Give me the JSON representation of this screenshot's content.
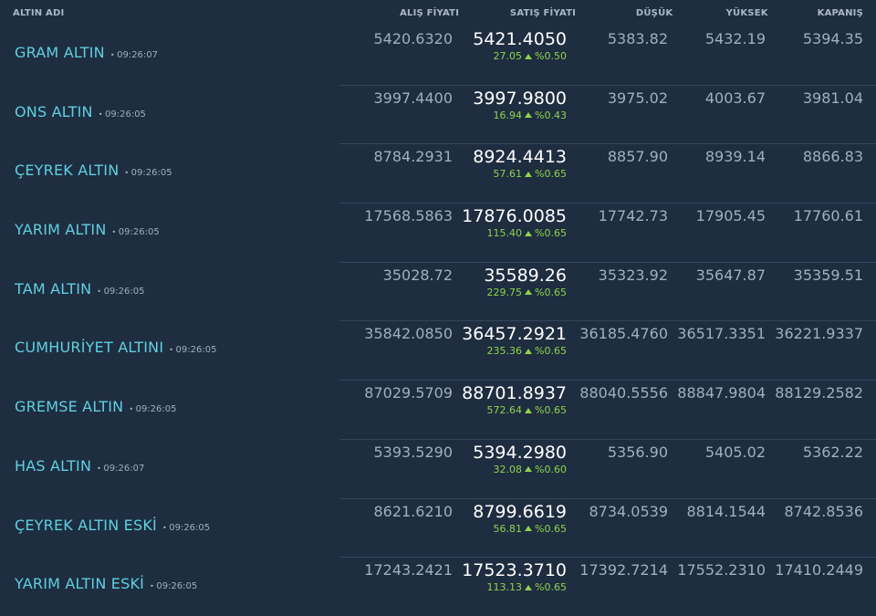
{
  "header": {
    "name": "ALTIN ADI",
    "alis": "ALIŞ FİYATI",
    "satis": "SATIŞ FİYATI",
    "dusuk": "DÜŞÜK",
    "yuksek": "YÜKSEK",
    "kapanis": "KAPANIŞ"
  },
  "rows": [
    {
      "name": "GRAM ALTIN",
      "time": "09:26:07",
      "alis": "5420.6320",
      "satis": "5421.4050",
      "change": "27.05",
      "pct": "%0.50",
      "dusuk": "5383.82",
      "yuksek": "5432.19",
      "kapanis": "5394.35"
    },
    {
      "name": "ONS ALTIN",
      "time": "09:26:05",
      "alis": "3997.4400",
      "satis": "3997.9800",
      "change": "16.94",
      "pct": "%0.43",
      "dusuk": "3975.02",
      "yuksek": "4003.67",
      "kapanis": "3981.04"
    },
    {
      "name": "ÇEYREK ALTIN",
      "time": "09:26:05",
      "alis": "8784.2931",
      "satis": "8924.4413",
      "change": "57.61",
      "pct": "%0.65",
      "dusuk": "8857.90",
      "yuksek": "8939.14",
      "kapanis": "8866.83"
    },
    {
      "name": "YARIM ALTIN",
      "time": "09:26:05",
      "alis": "17568.5863",
      "satis": "17876.0085",
      "change": "115.40",
      "pct": "%0.65",
      "dusuk": "17742.73",
      "yuksek": "17905.45",
      "kapanis": "17760.61"
    },
    {
      "name": "TAM ALTIN",
      "time": "09:26:05",
      "alis": "35028.72",
      "satis": "35589.26",
      "change": "229.75",
      "pct": "%0.65",
      "dusuk": "35323.92",
      "yuksek": "35647.87",
      "kapanis": "35359.51"
    },
    {
      "name": "CUMHURİYET ALTINI",
      "time": "09:26:05",
      "alis": "35842.0850",
      "satis": "36457.2921",
      "change": "235.36",
      "pct": "%0.65",
      "dusuk": "36185.4760",
      "yuksek": "36517.3351",
      "kapanis": "36221.9337"
    },
    {
      "name": "GREMSE ALTIN",
      "time": "09:26:05",
      "alis": "87029.5709",
      "satis": "88701.8937",
      "change": "572.64",
      "pct": "%0.65",
      "dusuk": "88040.5556",
      "yuksek": "88847.9804",
      "kapanis": "88129.2582"
    },
    {
      "name": "HAS ALTIN",
      "time": "09:26:07",
      "alis": "5393.5290",
      "satis": "5394.2980",
      "change": "32.08",
      "pct": "%0.60",
      "dusuk": "5356.90",
      "yuksek": "5405.02",
      "kapanis": "5362.22"
    },
    {
      "name": "ÇEYREK ALTIN ESKİ",
      "time": "09:26:05",
      "alis": "8621.6210",
      "satis": "8799.6619",
      "change": "56.81",
      "pct": "%0.65",
      "dusuk": "8734.0539",
      "yuksek": "8814.1544",
      "kapanis": "8742.8536"
    },
    {
      "name": "YARIM ALTIN ESKİ",
      "time": "09:26:05",
      "alis": "17243.2421",
      "satis": "17523.3710",
      "change": "113.13",
      "pct": "%0.65",
      "dusuk": "17392.7214",
      "yuksek": "17552.2310",
      "kapanis": "17410.2449"
    }
  ]
}
